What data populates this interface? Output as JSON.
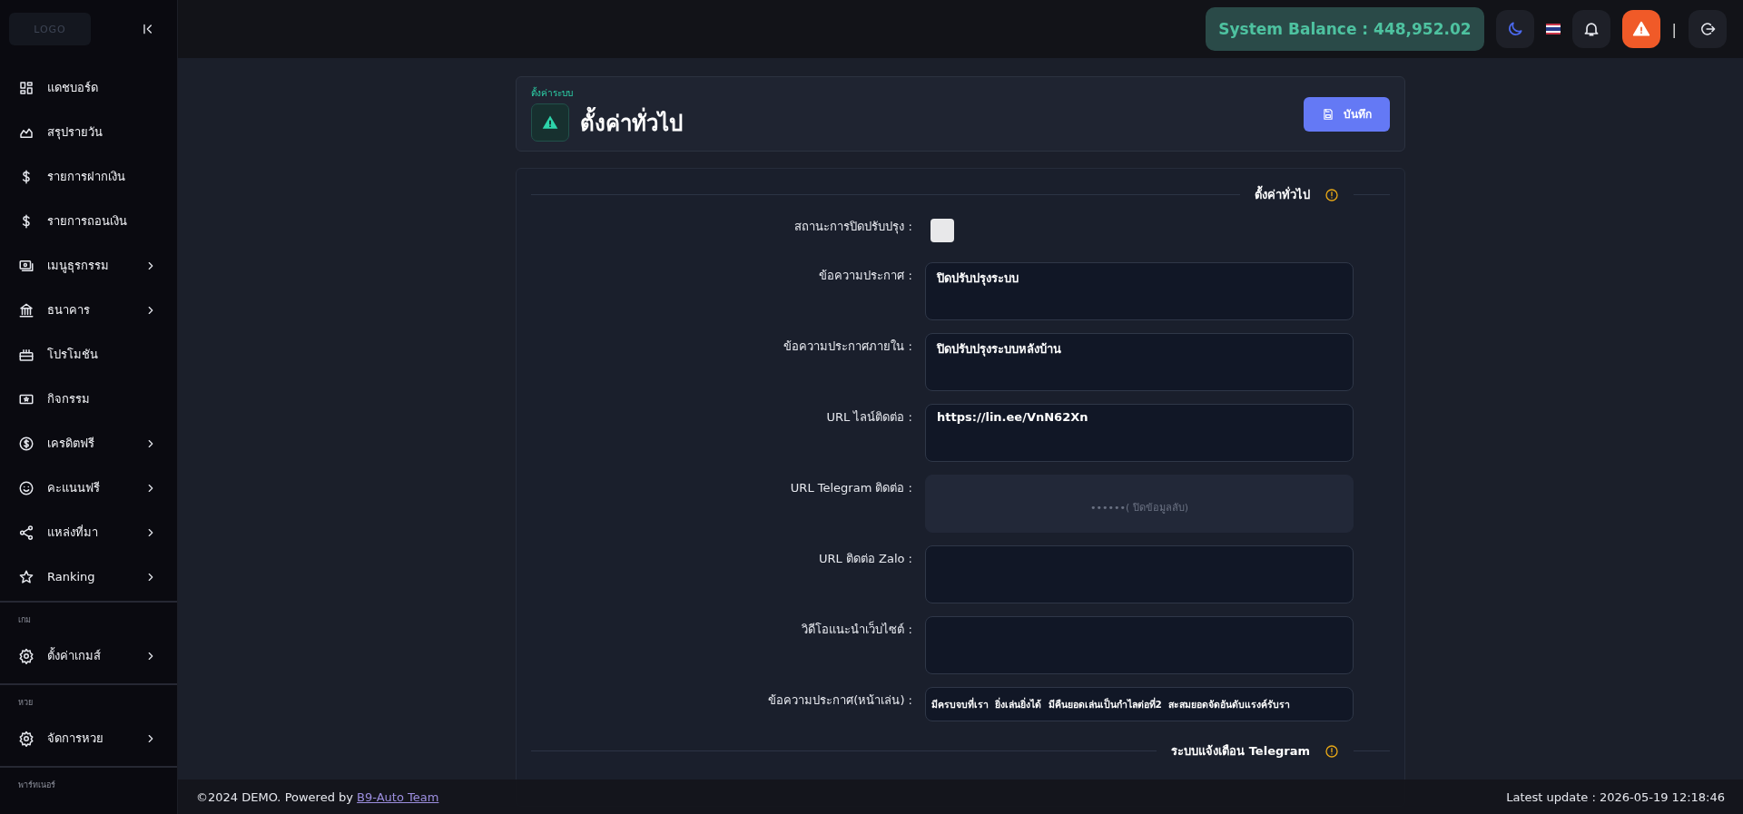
{
  "sidebar": {
    "logo": "LOGO",
    "groups": [
      {
        "items": [
          {
            "label": "แดชบอร์ด",
            "has_children": false
          },
          {
            "label": "สรุปรายวัน",
            "has_children": false
          },
          {
            "label": "รายการฝากเงิน",
            "has_children": false
          },
          {
            "label": "รายการถอนเงิน",
            "has_children": false
          },
          {
            "label": "เมนูธุรกรรม",
            "has_children": true
          },
          {
            "label": "ธนาคาร",
            "has_children": true
          },
          {
            "label": "โปรโมชัน",
            "has_children": false
          },
          {
            "label": "กิจกรรม",
            "has_children": false
          },
          {
            "label": "เครดิตฟรี",
            "has_children": true
          },
          {
            "label": "คะแนนฟรี",
            "has_children": true
          },
          {
            "label": "แหล่งที่มา",
            "has_children": true
          },
          {
            "label": "Ranking",
            "has_children": true
          }
        ]
      },
      {
        "heading": "เกม",
        "items": [
          {
            "label": "ตั้งค่าเกมส์",
            "has_children": true
          }
        ]
      },
      {
        "heading": "หวย",
        "items": [
          {
            "label": "จัดการหวย",
            "has_children": true
          }
        ]
      },
      {
        "heading": "พาร์ทเนอร์"
      }
    ]
  },
  "topbar": {
    "balance": "System Balance : 448,952.02",
    "separator": "|"
  },
  "page_header": {
    "breadcrumb": "ตั้งค่าระบบ",
    "title": "ตั้งค่าทั่วไป",
    "save_button": "บันทึก"
  },
  "sections": [
    {
      "title": "ตั้งค่าทั่วไป",
      "fields": [
        {
          "kind": "checkbox",
          "label": "สถานะการปิดปรับปรุง :",
          "checked": false
        },
        {
          "kind": "textarea",
          "label": "ข้อความประกาศ :",
          "value": "ปิดปรับปรุงระบบ"
        },
        {
          "kind": "textarea",
          "label": "ข้อความประกาศภายใน :",
          "value": "ปิดปรับปรุงระบบหลังบ้าน"
        },
        {
          "kind": "textarea",
          "label": "URL ไลน์ติดต่อ :",
          "value": "https://lin.ee/VnN62Xn"
        },
        {
          "kind": "secret",
          "label": "URL Telegram ติดต่อ :",
          "placeholder": "••••••( ปิดข้อมูลลับ)"
        },
        {
          "kind": "textarea",
          "label": "URL ติดต่อ Zalo :"
        },
        {
          "kind": "textarea",
          "label": "วิดีโอแนะนำเว็บไซต์ :"
        },
        {
          "kind": "input",
          "label": "ข้อความประกาศ(หน้าเล่น) :",
          "value": "มีครบจบที่เรา  ยิ่งเล่นยิ่งได้  มีคืนยอดเล่นเป็นกำไลต่อที่2  สะสมยอดจัดอันดับแรงค์รับรา"
        }
      ]
    },
    {
      "title": "ระบบแจ้งเตือน Telegram"
    }
  ],
  "footer": {
    "copyright": "©2024 DEMO. Powered by ",
    "link": "B9-Auto Team",
    "update": "Latest update : 2026-05-19 12:18:46"
  }
}
